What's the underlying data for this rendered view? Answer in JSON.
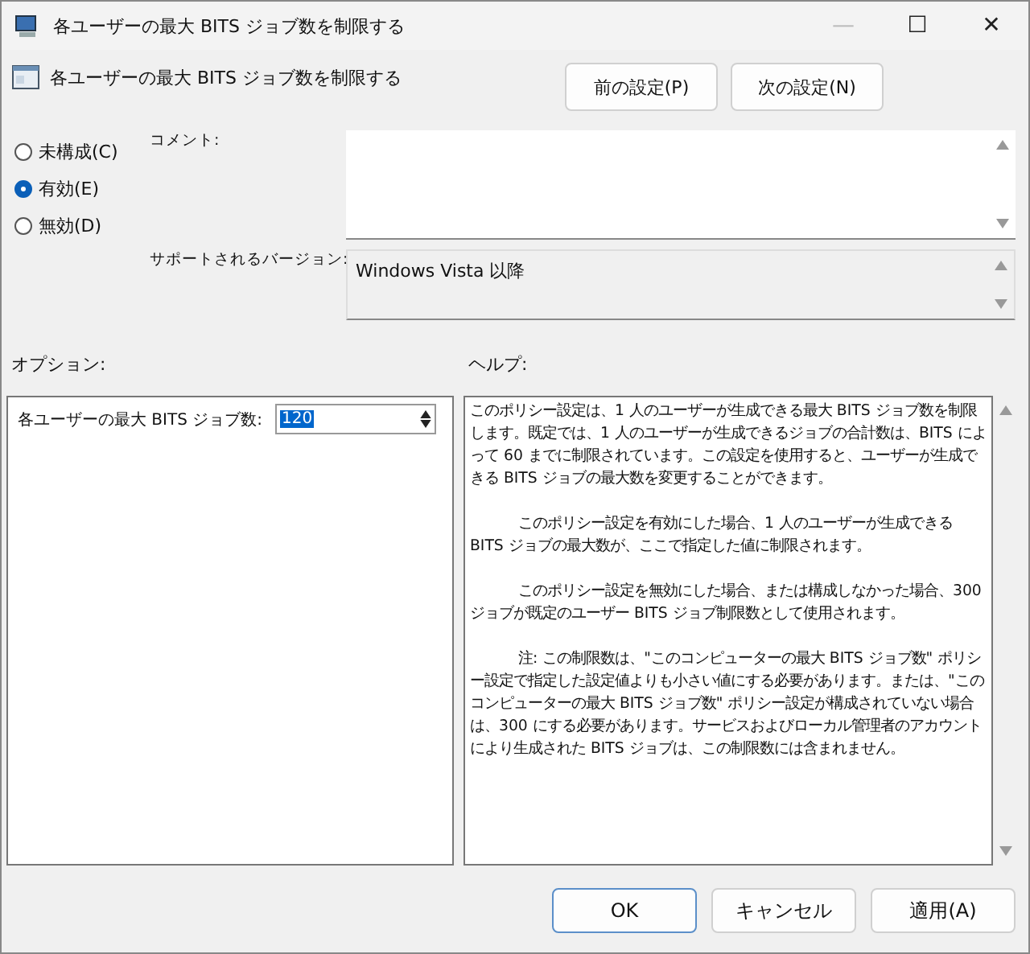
{
  "window": {
    "title": "各ユーザーの最大 BITS ジョブ数を制限する",
    "controls": [
      "—",
      "☐",
      "✕"
    ]
  },
  "header": {
    "title": "各ユーザーの最大 BITS ジョブ数を制限する",
    "buttons": [
      "前の設定(P)",
      "次の設定(N)"
    ]
  },
  "radios": [
    {
      "label": "未構成(C)",
      "selected": false
    },
    {
      "label": "有効(E)",
      "selected": true
    },
    {
      "label": "無効(D)",
      "selected": false
    }
  ],
  "comment": {
    "label": "コメント:"
  },
  "supported": {
    "label": "サポートされるバージョン:",
    "value": "Windows Vista 以降"
  },
  "options": {
    "label": "オプション:",
    "field_label": "各ユーザーの最大 BITS ジョブ数:",
    "value": "120"
  },
  "help": {
    "label": "ヘルプ:",
    "paragraphs": [
      {
        "text": "このポリシー設定は、1 人のユーザーが生成できる最大 BITS ジョブ数を制限します。既定では、1 人のユーザーが生成できるジョブの合計数は、BITS によって 60 までに制限されています。この設定を使用すると、ユーザーが生成できる BITS ジョブの最大数を変更することができます。",
        "indent": false
      },
      {
        "text": "このポリシー設定を有効にした場合、1 人のユーザーが生成できる BITS ジョブの最大数が、ここで指定した値に制限されます。",
        "indent": true
      },
      {
        "text": "このポリシー設定を無効にした場合、または構成しなかった場合、300 ジョブが既定のユーザー BITS ジョブ制限数として使用されます。",
        "indent": true
      },
      {
        "text": "注: この制限数は、\"このコンピューターの最大 BITS ジョブ数\" ポリシー設定で指定した設定値よりも小さい値にする必要があります。または、\"このコンピューターの最大 BITS ジョブ数\" ポリシー設定が構成されていない場合は、300 にする必要があります。サービスおよびローカル管理者のアカウントにより生成された BITS ジョブは、この制限数には含まれません。",
        "indent": true
      }
    ]
  },
  "buttons": [
    "OK",
    "キャンセル",
    "適用(A)"
  ]
}
